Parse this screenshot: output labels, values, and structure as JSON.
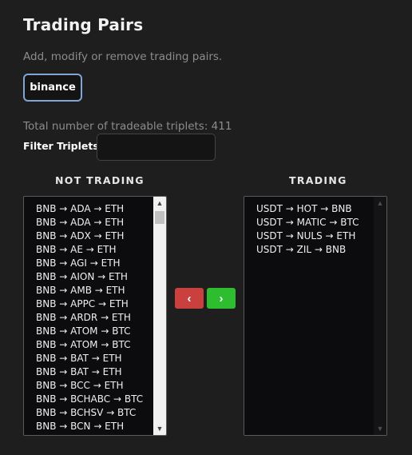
{
  "title": "Trading Pairs",
  "subtitle": "Add, modify or remove trading pairs.",
  "exchange_button": "binance",
  "total_text": "Total number of tradeable triplets: 411",
  "filter": {
    "label": "Filter Triplets",
    "value": "",
    "placeholder": ""
  },
  "not_trading": {
    "header": "NOT TRADING",
    "items": [
      "BNB → ADA → ETH",
      "BNB → ADA → ETH",
      "BNB → ADX → ETH",
      "BNB → AE → ETH",
      "BNB → AGI → ETH",
      "BNB → AION → ETH",
      "BNB → AMB → ETH",
      "BNB → APPC → ETH",
      "BNB → ARDR → ETH",
      "BNB → ATOM → BTC",
      "BNB → ATOM → BTC",
      "BNB → BAT → ETH",
      "BNB → BAT → ETH",
      "BNB → BCC → ETH",
      "BNB → BCHABC → BTC",
      "BNB → BCHSV → BTC",
      "BNB → BCN → ETH"
    ]
  },
  "trading": {
    "header": "TRADING",
    "items": [
      "USDT → HOT → BNB",
      "USDT → MATIC → BTC",
      "USDT → NULS → ETH",
      "USDT → ZIL → BNB"
    ]
  },
  "buttons": {
    "remove": "‹",
    "add": "›"
  },
  "icons": {
    "scroll_up": "chevron-up-icon",
    "scroll_down": "chevron-down-icon"
  },
  "scroll": {
    "up_glyph": "▲",
    "down_glyph": "▼"
  },
  "colors": {
    "background": "#1e1e1f",
    "accent_border": "#7fa6d6",
    "remove_button": "#c9403f",
    "add_button": "#2ebd2e"
  }
}
